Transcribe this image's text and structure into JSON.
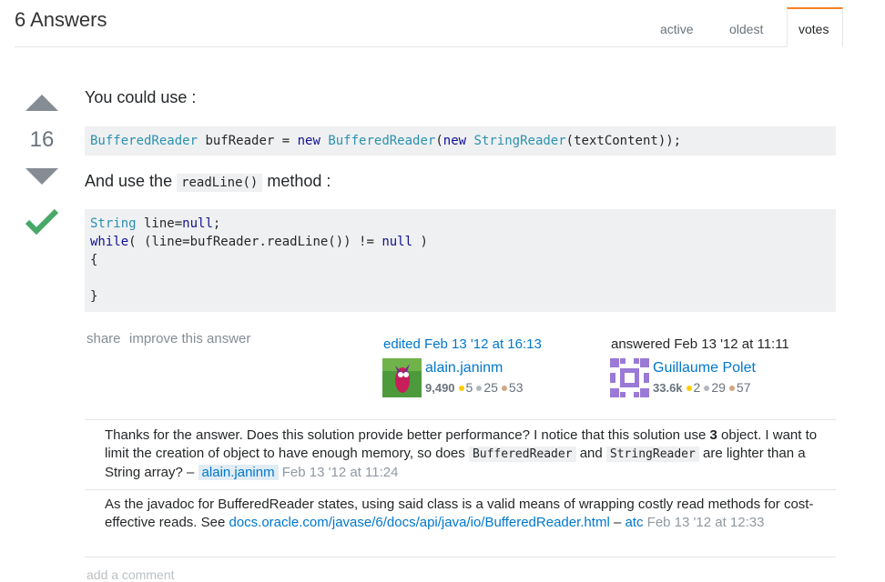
{
  "header": {
    "title": "6 Answers",
    "tabs": [
      {
        "label": "active"
      },
      {
        "label": "oldest"
      },
      {
        "label": "votes"
      }
    ]
  },
  "answer": {
    "vote_count": "16",
    "intro_text": "You could use :",
    "code1": {
      "type1": "BufferedReader",
      "var": " bufReader = ",
      "kw_new1": "new",
      "type2": "BufferedReader",
      "paren": "(",
      "kw_new2": "new",
      "type3": "StringReader",
      "rest": "(textContent));"
    },
    "use_text_before": "And use the ",
    "use_inline_code": "readLine()",
    "use_text_after": " method :",
    "code2": {
      "line1_type": "String",
      "line1_rest": " line=",
      "line1_null": "null",
      "line1_end": ";",
      "line2_kw": "while",
      "line2_mid": "( (line=bufReader.readLine()) != ",
      "line2_null": "null",
      "line2_end": " )",
      "line3": "{",
      "line5": "}"
    },
    "share_label": "share",
    "improve_label": "improve this answer",
    "edited": {
      "action": "edited Feb 13 '12 at 16:13",
      "user": "alain.janinm",
      "rep": "9,490",
      "gold": "5",
      "silver": "25",
      "bronze": "53"
    },
    "answered": {
      "action": "answered Feb 13 '12 at 11:11",
      "user": "Guillaume Polet",
      "rep": "33.6k",
      "gold": "2",
      "silver": "29",
      "bronze": "57"
    }
  },
  "comments": [
    {
      "text_a": "Thanks for the answer. Does this solution provide better performance? I notice that this solution use ",
      "bold": "3",
      "text_b": " object. I want to limit the creation of object to have enough memory, so does ",
      "code1": "BufferedReader",
      "text_c": " and ",
      "code2": "StringReader",
      "text_d": " are lighter than a String array? – ",
      "user": "alain.janinm",
      "date": "Feb 13 '12 at 11:24"
    },
    {
      "text_a": "As the javadoc for BufferedReader states, using said class is a valid means of wrapping costly read methods for cost-effective reads. See ",
      "link": "docs.oracle.com/javase/6/docs/api/java/io/BufferedReader.html",
      "text_b": " – ",
      "user": "atc",
      "date": "Feb 13 '12 at 12:33"
    }
  ],
  "add_comment_label": "add a comment",
  "colors": {
    "accent": "#f48024",
    "link": "#0077cc",
    "accepted": "#48a868",
    "code_bg": "#eff0f1"
  }
}
